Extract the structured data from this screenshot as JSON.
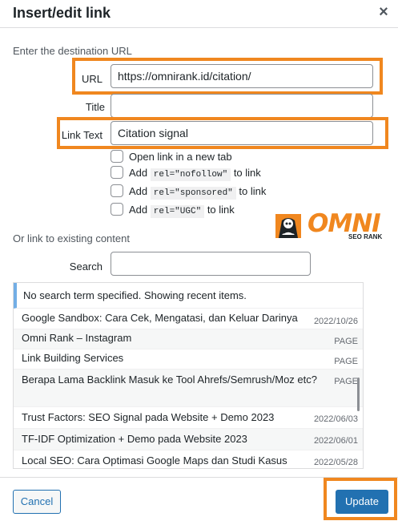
{
  "dialog": {
    "title": "Insert/edit link",
    "close_symbol": "×"
  },
  "instructions": "Enter the destination URL",
  "fields": {
    "url": {
      "label": "URL",
      "value": "https://omnirank.id/citation/"
    },
    "title": {
      "label": "Title",
      "value": ""
    },
    "link_text": {
      "label": "Link Text",
      "value": "Citation signal"
    }
  },
  "options": [
    {
      "text": "Open link in a new tab",
      "checked": false
    },
    {
      "pre": "Add",
      "code": "rel=\"nofollow\"",
      "post": "to link",
      "checked": false
    },
    {
      "pre": "Add",
      "code": "rel=\"sponsored\"",
      "post": "to link",
      "checked": false
    },
    {
      "pre": "Add",
      "code": "rel=\"UGC\"",
      "post": "to link",
      "checked": false
    }
  ],
  "logo": {
    "text": "OMNI",
    "sub": "SEO RANK",
    "icon": "robot-mascot-icon"
  },
  "existing": {
    "heading": "Or link to existing content",
    "search_label": "Search",
    "search_value": "",
    "notice": "No search term specified. Showing recent items.",
    "results": [
      {
        "title": "Google Sandbox: Cara Cek, Mengatasi, dan Keluar Darinya",
        "meta": "2022/10/26"
      },
      {
        "title": "Omni Rank – Instagram",
        "meta": "PAGE"
      },
      {
        "title": "Link Building Services",
        "meta": "PAGE"
      },
      {
        "title": "Berapa Lama Backlink Masuk ke Tool Ahrefs/Semrush/Moz etc?",
        "meta": "PAGE"
      },
      {
        "title": "Trust Factors: SEO Signal pada Website + Demo 2023",
        "meta": "2022/06/03"
      },
      {
        "title": "TF-IDF Optimization + Demo pada Website 2023",
        "meta": "2022/06/01"
      },
      {
        "title": "Local SEO: Cara Optimasi Google Maps dan Studi Kasus",
        "meta": "2022/05/28"
      }
    ]
  },
  "buttons": {
    "cancel": "Cancel",
    "update": "Update"
  },
  "colors": {
    "accent": "#2271b1",
    "highlight": "#f0871f",
    "notice_border": "#72aee6"
  }
}
